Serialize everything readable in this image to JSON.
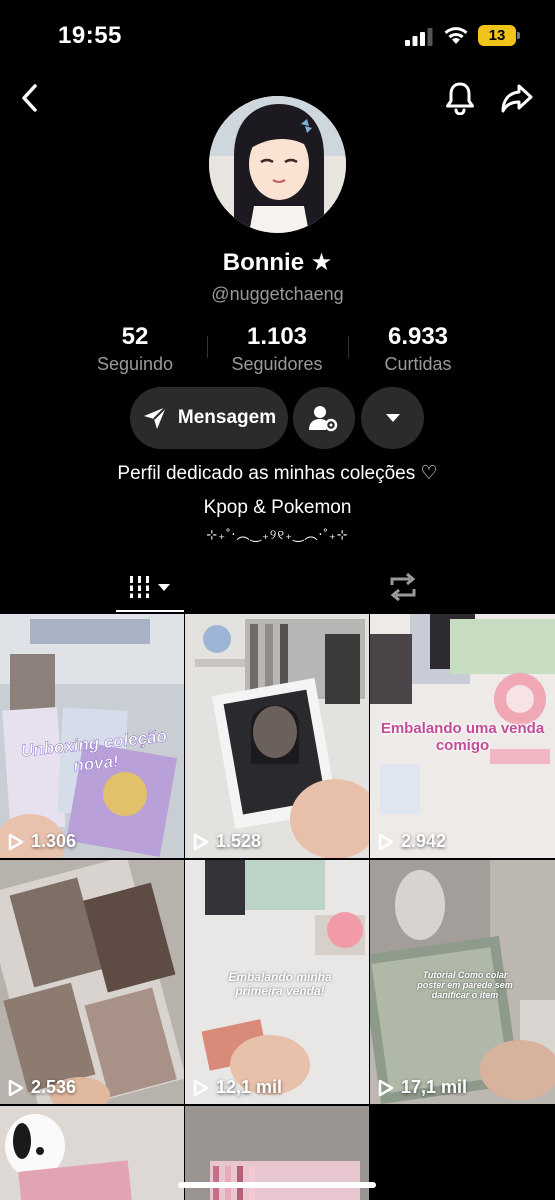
{
  "status": {
    "time": "19:55",
    "battery": "13"
  },
  "profile": {
    "name": "Bonnie ★",
    "handle": "@nuggetchaeng",
    "stats": [
      {
        "value": "52",
        "label": "Seguindo"
      },
      {
        "value": "1.103",
        "label": "Seguidores"
      },
      {
        "value": "6.933",
        "label": "Curtidas"
      }
    ],
    "message_label": "Mensagem",
    "bio": [
      "Perfil dedicado as minhas coleções ♡",
      "Kpop & Pokemon",
      "⊹₊˚‧︵‿₊୨୧₊‿︵‧˚₊⊹"
    ]
  },
  "videos": [
    {
      "views": "1.306",
      "overlay": "Unboxing coleção nova!"
    },
    {
      "views": "1.528",
      "overlay": ""
    },
    {
      "views": "2.942",
      "overlay": "Embalando uma venda comigo"
    },
    {
      "views": "2.536",
      "overlay": ""
    },
    {
      "views": "12,1 mil",
      "overlay": "Embalando minha primeira venda!"
    },
    {
      "views": "17,1 mil",
      "overlay": "Tutorial Como colar poster em parede sem danificar o item"
    },
    {
      "views": "",
      "overlay": ""
    },
    {
      "views": "",
      "overlay": ""
    }
  ],
  "colors": {
    "background": "#000000",
    "button": "#2b2b2b",
    "muted_text": "#9a9a9a",
    "battery": "#f0c419"
  }
}
